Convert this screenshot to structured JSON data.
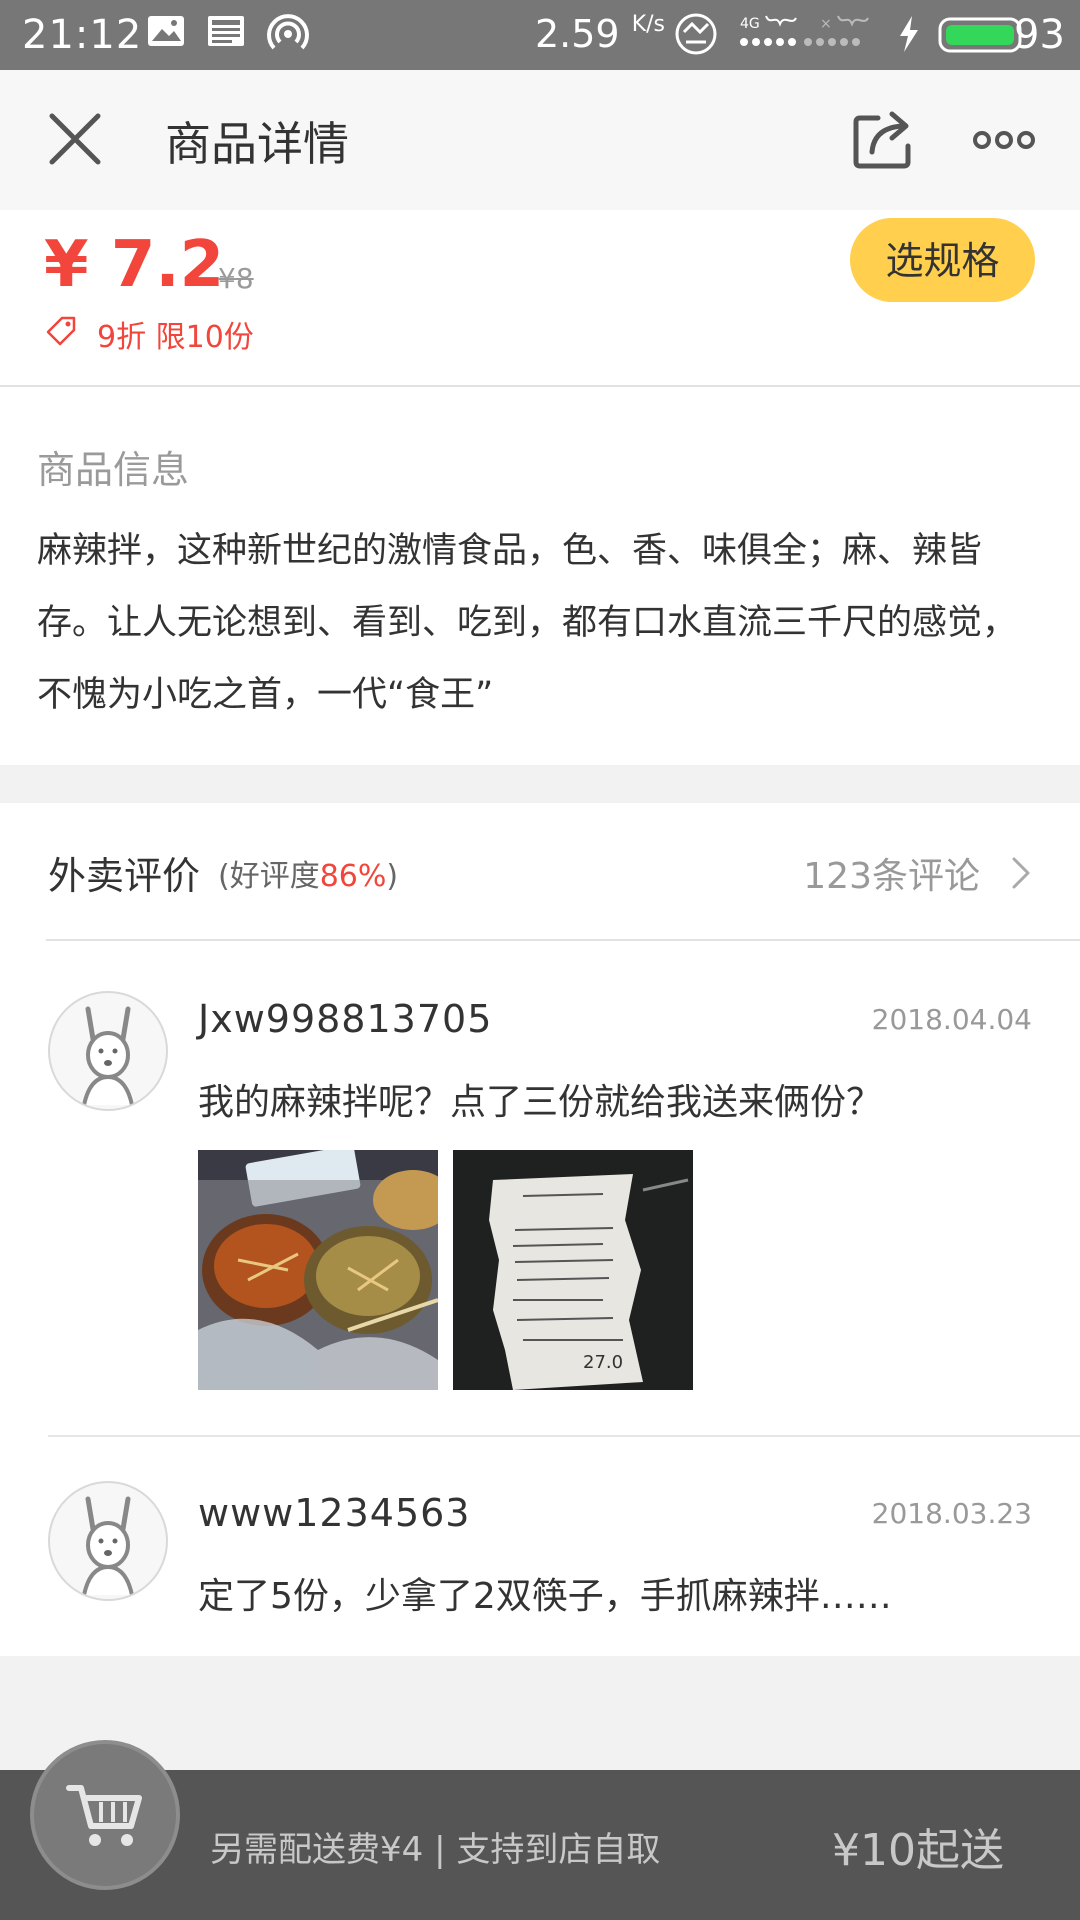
{
  "status_bar": {
    "time": "21:12",
    "net_speed": "2.59",
    "net_speed_unit": "K/s",
    "battery": "93",
    "icons": [
      "image-icon",
      "news-icon",
      "hotspot-icon",
      "app-badge-icon",
      "signal-4g-icon",
      "signal-icon",
      "charging-icon",
      "battery-icon"
    ]
  },
  "header": {
    "title": "商品详情",
    "icons": [
      "close-icon",
      "share-icon",
      "more-icon"
    ]
  },
  "price": {
    "current": "¥ 7.2",
    "original": "¥8",
    "discount": "9折 限10份",
    "spec_button": "选规格"
  },
  "info": {
    "title": "商品信息",
    "description": "麻辣拌，这种新世纪的激情食品，色、香、味俱全；麻、辣皆存。让人无论想到、看到、吃到，都有口水直流三千尺的感觉，不愧为小吃之首，一代“食王”"
  },
  "reviews": {
    "title": "外卖评价",
    "rate_prefix": "(好评度",
    "rate_value": "86%",
    "rate_suffix": ")",
    "count": "123条评论",
    "items": [
      {
        "user": "Jxw998813705",
        "date": "2018.04.04",
        "text": "我的麻辣拌呢？点了三份就给我送来俩份？",
        "photos": [
          "food-photo",
          "receipt-photo"
        ]
      },
      {
        "user": "www1234563",
        "date": "2018.03.23",
        "text": "定了5份，少拿了2双筷子，手抓麻辣拌……"
      }
    ]
  },
  "bottom_bar": {
    "fee_text": "另需配送费¥4 | 支持到店自取",
    "min_order": "¥10起送"
  },
  "colors": {
    "accent_red": "#f2453b",
    "button_yellow": "#ffcf4d",
    "status_bar": "#777777",
    "bottom_bar": "#555555"
  }
}
